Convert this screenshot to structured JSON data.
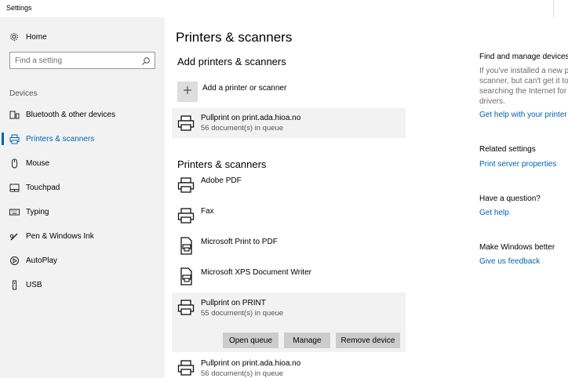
{
  "window": {
    "title": "Settings"
  },
  "sidebar": {
    "home_label": "Home",
    "search_placeholder": "Find a setting",
    "section_label": "Devices",
    "items": [
      {
        "label": "Bluetooth & other devices",
        "icon": "bluetooth-devices-icon"
      },
      {
        "label": "Printers & scanners",
        "icon": "printer-icon",
        "active": true
      },
      {
        "label": "Mouse",
        "icon": "mouse-icon"
      },
      {
        "label": "Touchpad",
        "icon": "touchpad-icon"
      },
      {
        "label": "Typing",
        "icon": "keyboard-icon"
      },
      {
        "label": "Pen & Windows Ink",
        "icon": "pen-icon"
      },
      {
        "label": "AutoPlay",
        "icon": "autoplay-icon"
      },
      {
        "label": "USB",
        "icon": "usb-icon"
      }
    ]
  },
  "main": {
    "title": "Printers & scanners",
    "add_section": {
      "heading": "Add printers & scanners",
      "add_label": "Add a printer or scanner",
      "found": {
        "name": "Pullprint on print.ada.hioa.no",
        "status": "56 document(s) in queue"
      }
    },
    "list_section": {
      "heading": "Printers & scanners",
      "devices": [
        {
          "name": "Adobe PDF",
          "status": "",
          "icon": "printer-icon"
        },
        {
          "name": "Fax",
          "status": "",
          "icon": "printer-icon"
        },
        {
          "name": "Microsoft Print to PDF",
          "status": "",
          "icon": "document-printer-icon"
        },
        {
          "name": "Microsoft XPS Document Writer",
          "status": "",
          "icon": "document-printer-icon"
        },
        {
          "name": "Pullprint on PRINT",
          "status": "55 document(s) in queue",
          "icon": "printer-icon",
          "selected": true
        },
        {
          "name": "Pullprint on print.ada.hioa.no",
          "status": "56 document(s) in queue",
          "icon": "printer-icon"
        }
      ],
      "actions": {
        "open_queue": "Open queue",
        "manage": "Manage",
        "remove": "Remove device"
      }
    }
  },
  "right": {
    "find_heading": "Find and manage devices",
    "find_lines": [
      "If you've installed a new pr",
      "scanner, but can't get it to",
      "searching the Internet for d",
      "drivers."
    ],
    "find_link": "Get help with your printer",
    "related_heading": "Related settings",
    "related_link": "Print server properties",
    "question_heading": "Have a question?",
    "question_link": "Get help",
    "better_heading": "Make Windows better",
    "better_link": "Give us feedback"
  },
  "colors": {
    "accent": "#0063b1",
    "sidebar_bg": "#f2f2f2",
    "button_bg": "#cccccc"
  }
}
